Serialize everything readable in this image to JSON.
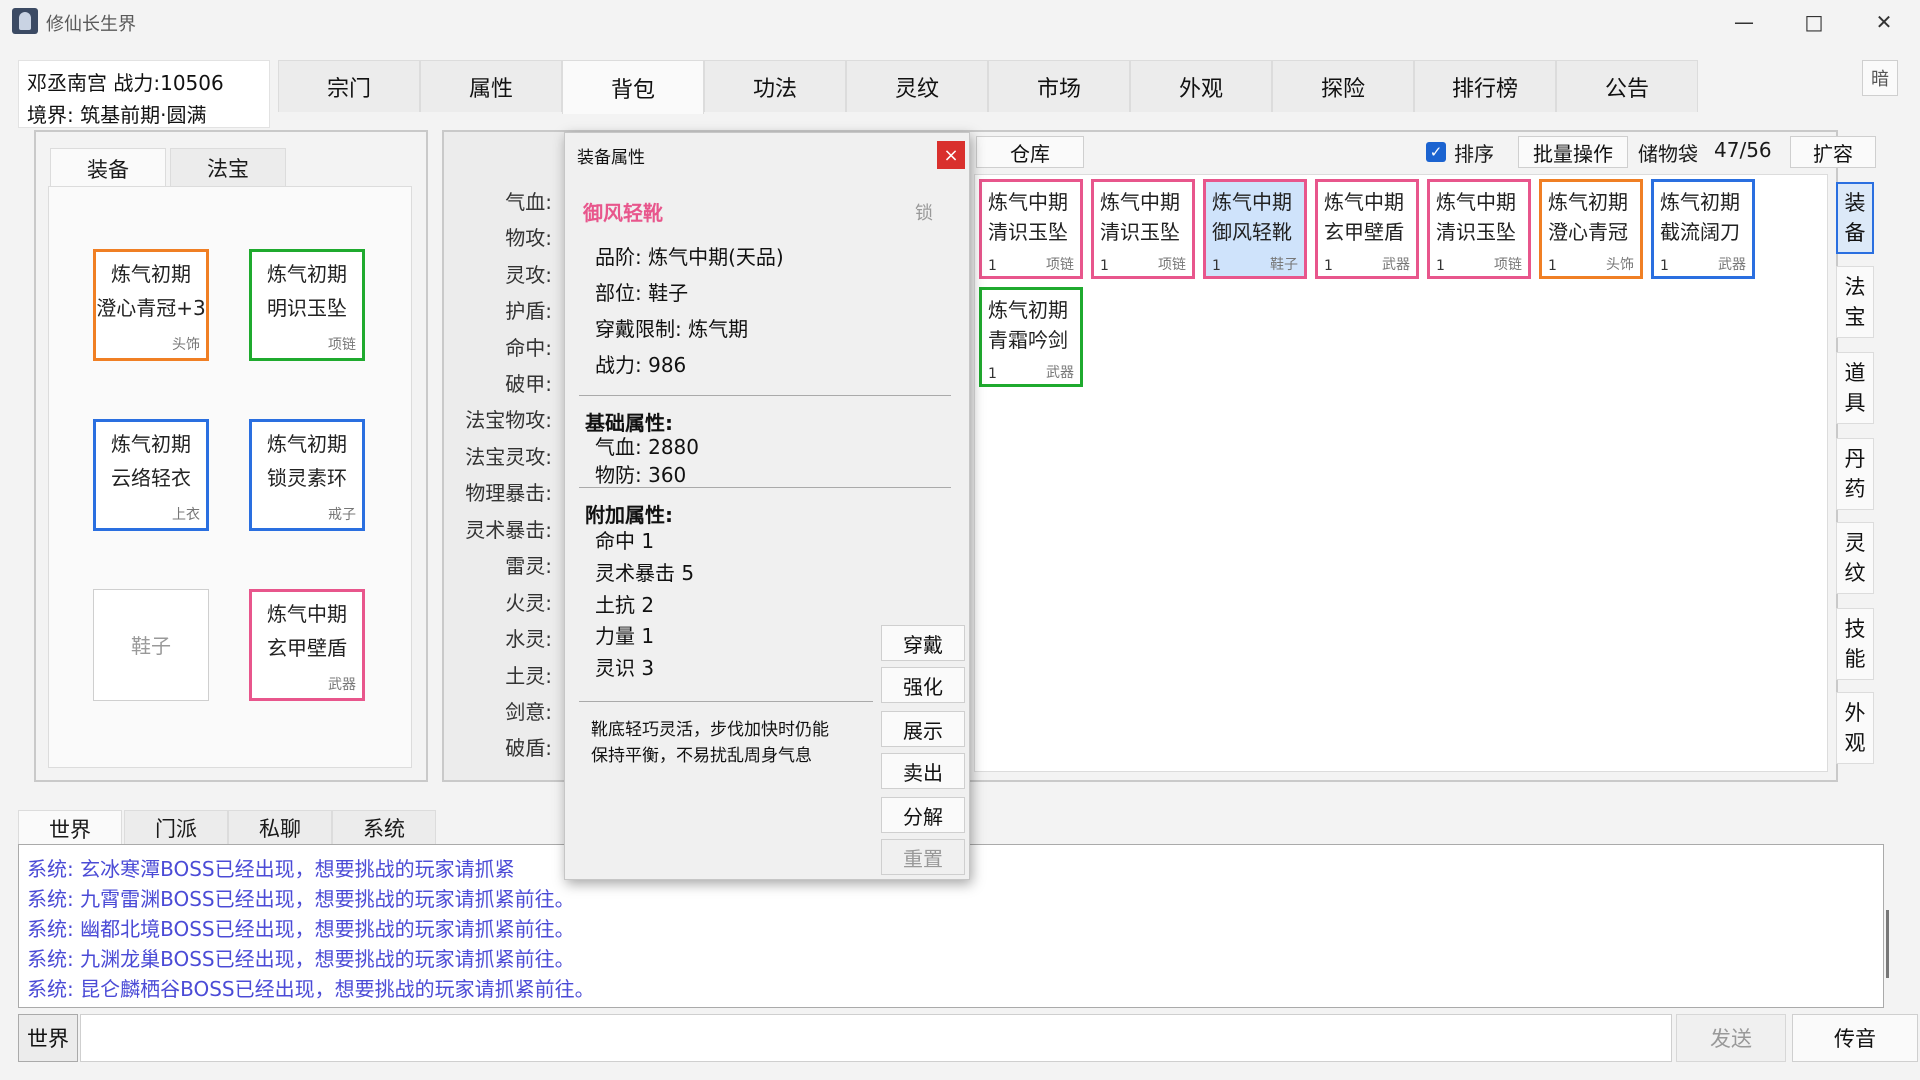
{
  "window": {
    "title": "修仙长生界"
  },
  "player": {
    "name_power": "邓丞南宫  战力:10506",
    "realm": "境界: 筑基前期·圆满"
  },
  "main_tabs": [
    {
      "label": "宗门"
    },
    {
      "label": "属性"
    },
    {
      "label": "背包"
    },
    {
      "label": "功法"
    },
    {
      "label": "灵纹"
    },
    {
      "label": "市场"
    },
    {
      "label": "外观"
    },
    {
      "label": "探险"
    },
    {
      "label": "排行榜"
    },
    {
      "label": "公告"
    }
  ],
  "theme_button": "暗",
  "equip_panel": {
    "tabs": [
      {
        "label": "装备"
      },
      {
        "label": "法宝"
      }
    ],
    "slots": [
      {
        "line1": "炼气初期",
        "line2": "澄心青冠+3",
        "type": "头饰"
      },
      {
        "line1": "炼气初期",
        "line2": "明识玉坠",
        "type": "项链"
      },
      {
        "line1": "炼气初期",
        "line2": "云络轻衣",
        "type": "上衣"
      },
      {
        "line1": "炼气初期",
        "line2": "锁灵素环",
        "type": "戒子"
      },
      {
        "placeholder": "鞋子"
      },
      {
        "line1": "炼气中期",
        "line2": "玄甲壁盾",
        "type": "武器"
      }
    ]
  },
  "attributes": {
    "labels": [
      "气血:",
      "物攻:",
      "灵攻:",
      "护盾:",
      "命中:",
      "破甲:",
      "法宝物攻:",
      "法宝灵攻:",
      "物理暴击:",
      "灵术暴击:",
      "雷灵:",
      "火灵:",
      "水灵:",
      "土灵:",
      "剑意:",
      "破盾:"
    ]
  },
  "popup": {
    "title": "装备属性",
    "close": "×",
    "item_name": "御风轻靴",
    "lock": "锁",
    "grade": "品阶:   炼气中期(天品)",
    "part": "部位:   鞋子",
    "limit": "穿戴限制:   炼气期",
    "power": "战力:   986",
    "base_header": "基础属性:",
    "base_stats": [
      "气血:   2880",
      "物防:   360"
    ],
    "extra_header": "附加属性:",
    "extra_stats": [
      "命中  1",
      "灵术暴击  5",
      "土抗  2",
      "力量  1",
      "灵识  3"
    ],
    "desc_line1": "靴底轻巧灵活，步伐加快时仍能",
    "desc_line2": "保持平衡，不易扰乱周身气息",
    "buttons": [
      {
        "label": "穿戴"
      },
      {
        "label": "强化"
      },
      {
        "label": "展示"
      },
      {
        "label": "卖出"
      },
      {
        "label": "分解"
      },
      {
        "label": "重置"
      }
    ]
  },
  "bag": {
    "warehouse_button": "仓库",
    "sort_checked": true,
    "sort_label": "排序",
    "batch_button": "批量操作",
    "capacity_label": "储物袋",
    "capacity": "47/56",
    "expand_button": "扩容",
    "items": [
      {
        "line1": "炼气中期",
        "line2": "清识玉坠",
        "count": "1",
        "type": "项链"
      },
      {
        "line1": "炼气中期",
        "line2": "清识玉坠",
        "count": "1",
        "type": "项链"
      },
      {
        "line1": "炼气中期",
        "line2": "御风轻靴",
        "count": "1",
        "type": "鞋子"
      },
      {
        "line1": "炼气中期",
        "line2": "玄甲壁盾",
        "count": "1",
        "type": "武器"
      },
      {
        "line1": "炼气中期",
        "line2": "清识玉坠",
        "count": "1",
        "type": "项链"
      },
      {
        "line1": "炼气初期",
        "line2": "澄心青冠",
        "count": "1",
        "type": "头饰"
      },
      {
        "line1": "炼气初期",
        "line2": "截流阔刀",
        "count": "1",
        "type": "武器"
      },
      {
        "line1": "炼气初期",
        "line2": "青霜吟剑",
        "count": "1",
        "type": "武器"
      }
    ],
    "categories": [
      {
        "c1": "装",
        "c2": "备"
      },
      {
        "c1": "法",
        "c2": "宝"
      },
      {
        "c1": "道",
        "c2": "具"
      },
      {
        "c1": "丹",
        "c2": "药"
      },
      {
        "c1": "灵",
        "c2": "纹"
      },
      {
        "c1": "技",
        "c2": "能"
      },
      {
        "c1": "外",
        "c2": "观"
      }
    ]
  },
  "chat": {
    "tabs": [
      {
        "label": "世界"
      },
      {
        "label": "门派"
      },
      {
        "label": "私聊"
      },
      {
        "label": "系统"
      }
    ],
    "messages": [
      "系统:  玄冰寒潭BOSS已经出现，想要挑战的玩家请抓紧",
      "系统:  九霄雷渊BOSS已经出现，想要挑战的玩家请抓紧前往。",
      "系统:  幽都北境BOSS已经出现，想要挑战的玩家请抓紧前往。",
      "系统:  九渊龙巢BOSS已经出现，想要挑战的玩家请抓紧前往。",
      "系统:  昆仑麟栖谷BOSS已经出现，想要挑战的玩家请抓紧前往。"
    ],
    "channel": "世界",
    "input_value": "",
    "send": "发送",
    "voice": "传音"
  },
  "colors": {
    "rarity_orange": "#f07f24",
    "rarity_green": "#1faa2e",
    "rarity_blue": "#2a6fe0",
    "rarity_pink": "#e8568c",
    "chat_text": "#4b4bd6",
    "item_name_pink": "#e8568c",
    "close_red": "#d9302d"
  }
}
